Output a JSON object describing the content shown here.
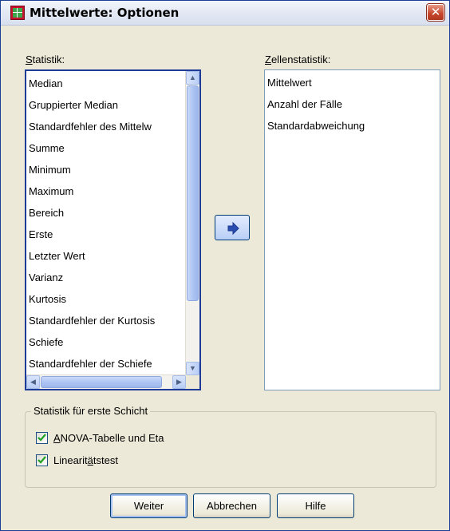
{
  "window": {
    "title": "Mittelwerte: Optionen",
    "close_label": "✕"
  },
  "statistik": {
    "label": "Statistik:",
    "items": [
      "Median",
      "Gruppierter Median",
      "Standardfehler des Mittelw",
      "Summe",
      "Minimum",
      "Maximum",
      "Bereich",
      "Erste",
      "Letzter Wert",
      "Varianz",
      "Kurtosis",
      "Standardfehler der Kurtosis",
      "Schiefe",
      "Standardfehler der Schiefe"
    ]
  },
  "zellenstatistik": {
    "label": "Zellenstatistik:",
    "items": [
      "Mittelwert",
      "Anzahl der Fälle",
      "Standardabweichung"
    ]
  },
  "group": {
    "legend": "Statistik für erste Schicht",
    "anova": {
      "label": "ANOVA-Tabelle und Eta",
      "checked": true
    },
    "linear": {
      "label": "Linearitätstest",
      "checked": true
    }
  },
  "buttons": {
    "weiter": "Weiter",
    "abbrechen": "Abbrechen",
    "hilfe": "Hilfe"
  },
  "colors": {
    "accent": "#1d3b97",
    "close": "#c5452b"
  }
}
